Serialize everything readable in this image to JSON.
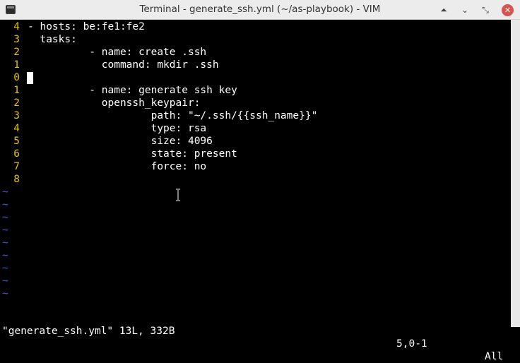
{
  "window": {
    "title": "Terminal - generate_ssh.yml (~/as-playbook) - VIM",
    "buttons": {
      "up": "⏶",
      "minimize": "⌄",
      "maximize": "⤡",
      "close": "✕"
    }
  },
  "editor": {
    "lines": [
      {
        "num": "4",
        "text": "- hosts: be:fe1:fe2"
      },
      {
        "num": "3",
        "text": "  tasks:"
      },
      {
        "num": "2",
        "text": "          - name: create .ssh"
      },
      {
        "num": "1",
        "text": "            command: mkdir .ssh"
      },
      {
        "num": "0",
        "text": ""
      },
      {
        "num": "1",
        "text": "          - name: generate ssh key"
      },
      {
        "num": "2",
        "text": "            openssh_keypair:"
      },
      {
        "num": "3",
        "text": "                    path: \"~/.ssh/{{ssh_name}}\""
      },
      {
        "num": "4",
        "text": "                    type: rsa"
      },
      {
        "num": "5",
        "text": "                    size: 4096"
      },
      {
        "num": "6",
        "text": "                    state: present"
      },
      {
        "num": "7",
        "text": "                    force: no"
      },
      {
        "num": "8",
        "text": ""
      }
    ],
    "empty_marker": "~"
  },
  "status": {
    "message": "\"generate_ssh.yml\" 13L, 332B",
    "position": "5,0-1",
    "scroll": "All"
  },
  "colors": {
    "line_number": "#e6c200",
    "tilde": "#3b5bdb",
    "text": "#ffffff",
    "background": "#000000",
    "close_button": "#d9534f"
  }
}
